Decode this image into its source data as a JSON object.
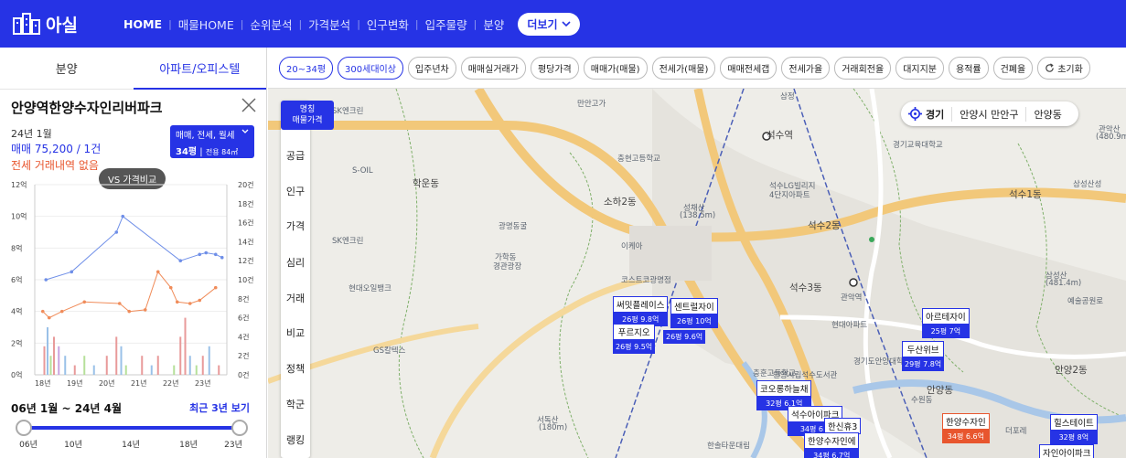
{
  "header": {
    "logo": "아실",
    "nav": [
      "HOME",
      "매물HOME",
      "순위분석",
      "가격분석",
      "인구변화",
      "입주물량",
      "분양"
    ],
    "more": "더보기"
  },
  "left": {
    "tabs": [
      "분양",
      "아파트/오피스텔"
    ],
    "title": "안양역한양수자인리버파크",
    "date": "24년 1월",
    "price": "매매 75,200 / 1건",
    "no_rent": "전세 거래내역 없음",
    "type_line1": "매매, 전세, 월세",
    "type_size": "34평",
    "type_area": "전용 84㎡",
    "vs": "VS 가격비교",
    "period": "06년 1월 ~ 24년 4월",
    "recent": "최근 3년 보기",
    "slider_ticks": [
      "06년",
      "10년",
      "14년",
      "18년",
      "23년"
    ]
  },
  "chart_data": {
    "type": "line",
    "title": "",
    "x_ticks": [
      "18년",
      "19년",
      "20년",
      "21년",
      "22년",
      "23년"
    ],
    "y_left_ticks": [
      "12억",
      "10억",
      "8억",
      "6억",
      "4억",
      "2억",
      "0억"
    ],
    "y_right_ticks": [
      "20건",
      "18건",
      "16건",
      "14건",
      "12건",
      "10건",
      "8건",
      "6건",
      "4건",
      "2건",
      "0건"
    ],
    "ylim_left": [
      0,
      12
    ],
    "ylim_right": [
      0,
      20
    ],
    "series": [
      {
        "name": "",
        "color": "#6f8fe8",
        "points": [
          [
            2018.1,
            6.0
          ],
          [
            2018.9,
            6.5
          ],
          [
            2020.3,
            9.0
          ],
          [
            2020.5,
            10.0
          ],
          [
            2022.3,
            7.2
          ],
          [
            2022.9,
            7.6
          ],
          [
            2023.1,
            7.7
          ],
          [
            2023.4,
            7.6
          ],
          [
            2023.6,
            7.4
          ]
        ]
      },
      {
        "name": "",
        "color": "#f08c5a",
        "points": [
          [
            2018.0,
            4.0
          ],
          [
            2018.2,
            3.6
          ],
          [
            2018.6,
            4.0
          ],
          [
            2019.3,
            4.6
          ],
          [
            2020.4,
            4.5
          ],
          [
            2020.7,
            4.0
          ],
          [
            2021.2,
            4.1
          ],
          [
            2021.6,
            6.5
          ],
          [
            2022.0,
            5.5
          ],
          [
            2022.2,
            4.6
          ],
          [
            2022.6,
            4.5
          ],
          [
            2022.9,
            4.7
          ],
          [
            2023.4,
            5.5
          ]
        ]
      }
    ],
    "volume": [
      [
        2018.05,
        3,
        "#e89a9a"
      ],
      [
        2018.15,
        5,
        "#9ac1e8"
      ],
      [
        2018.25,
        2,
        "#b6e09a"
      ],
      [
        2018.35,
        4,
        "#e89a9a"
      ],
      [
        2018.5,
        3,
        "#c9a4e0"
      ],
      [
        2018.7,
        2,
        "#9ac1e8"
      ],
      [
        2019.0,
        1,
        "#e89a9a"
      ],
      [
        2019.3,
        2,
        "#b6e09a"
      ],
      [
        2019.6,
        1,
        "#9ac1e8"
      ],
      [
        2020.0,
        2,
        "#e89a9a"
      ],
      [
        2020.3,
        4,
        "#e89a9a"
      ],
      [
        2020.45,
        3,
        "#9ac1e8"
      ],
      [
        2020.6,
        1,
        "#b6e09a"
      ],
      [
        2021.1,
        2,
        "#e89a9a"
      ],
      [
        2021.4,
        1,
        "#9ac1e8"
      ],
      [
        2021.6,
        2,
        "#e89a9a"
      ],
      [
        2022.1,
        1,
        "#b6e09a"
      ],
      [
        2022.3,
        4,
        "#e89a9a"
      ],
      [
        2022.45,
        6,
        "#e89a9a"
      ],
      [
        2022.6,
        2,
        "#9ac1e8"
      ],
      [
        2022.8,
        1,
        "#b6e09a"
      ],
      [
        2023.0,
        2,
        "#e89a9a"
      ],
      [
        2023.2,
        3,
        "#9ac1e8"
      ],
      [
        2023.5,
        1,
        "#e89a9a"
      ]
    ]
  },
  "filters": [
    "20~34평",
    "300세대이상",
    "입주년차",
    "매매실거래가",
    "평당가격",
    "매매가(매물)",
    "전세가(매물)",
    "매매전세갭",
    "전세가율",
    "거래회전율",
    "대지지분",
    "용적률",
    "건폐율",
    "초기화"
  ],
  "active_filters": [
    0,
    1
  ],
  "side_menu": {
    "head": [
      "명칭",
      "매물가격"
    ],
    "items": [
      "공급",
      "인구",
      "가격",
      "심리",
      "거래",
      "비교",
      "정책",
      "학군",
      "랭킹"
    ]
  },
  "location": {
    "region": "경기",
    "city": "안양시 만안구",
    "dong": "안양동"
  },
  "markers": [
    {
      "name": "써밋플레이스",
      "info": "26평 9.8억"
    },
    {
      "name": "센트럴자이",
      "info": "26평 10억"
    },
    {
      "name": "푸르지오",
      "info": "26평 9.5억"
    },
    {
      "name": "",
      "info": "26평 9.6억"
    },
    {
      "name": "아르테자이",
      "info": "25평 7억"
    },
    {
      "name": "두산위브",
      "info": "29평 7.8억"
    },
    {
      "name": "코오롱하늘채",
      "info": "32평 6.1억"
    },
    {
      "name": "석수아이파크",
      "info": "34평 6.3"
    },
    {
      "name": "한신휴3",
      "info": ""
    },
    {
      "name": "한양수자인에",
      "info": "34평 6.7억"
    },
    {
      "name": "한양수자인",
      "info": "34평 6.6억"
    },
    {
      "name": "힐스테이트",
      "info": "32평 8억"
    },
    {
      "name": "자인아이파크",
      "info": ""
    }
  ],
  "map_labels": [
    "SK엔크린",
    "만안고가",
    "삼정",
    "석수역",
    "석수LG빌리지",
    "4단지아파트",
    "석수1동",
    "관악산",
    "(480.9m)",
    "삼성산",
    "(481.4m)",
    "S-OIL",
    "학운동",
    "충현고등학교",
    "소하2동",
    "성채산",
    "(138.5m)",
    "석수2동",
    "삼성산성",
    "광명동굴",
    "가학동",
    "경관광장",
    "이케아",
    "코스트코광명점",
    "SK엔크린",
    "현대오일뱅크",
    "GS칼텍스",
    "관악역",
    "현대아파트",
    "석수3동",
    "예술공원로",
    "안양동",
    "경기교육대학교",
    "충훈고등학교",
    "안양시립석수도서관",
    "경기도안양대학교",
    "안양2동",
    "수원동",
    "서독산",
    "(180m)",
    "한솔타운대림",
    "더포레"
  ]
}
